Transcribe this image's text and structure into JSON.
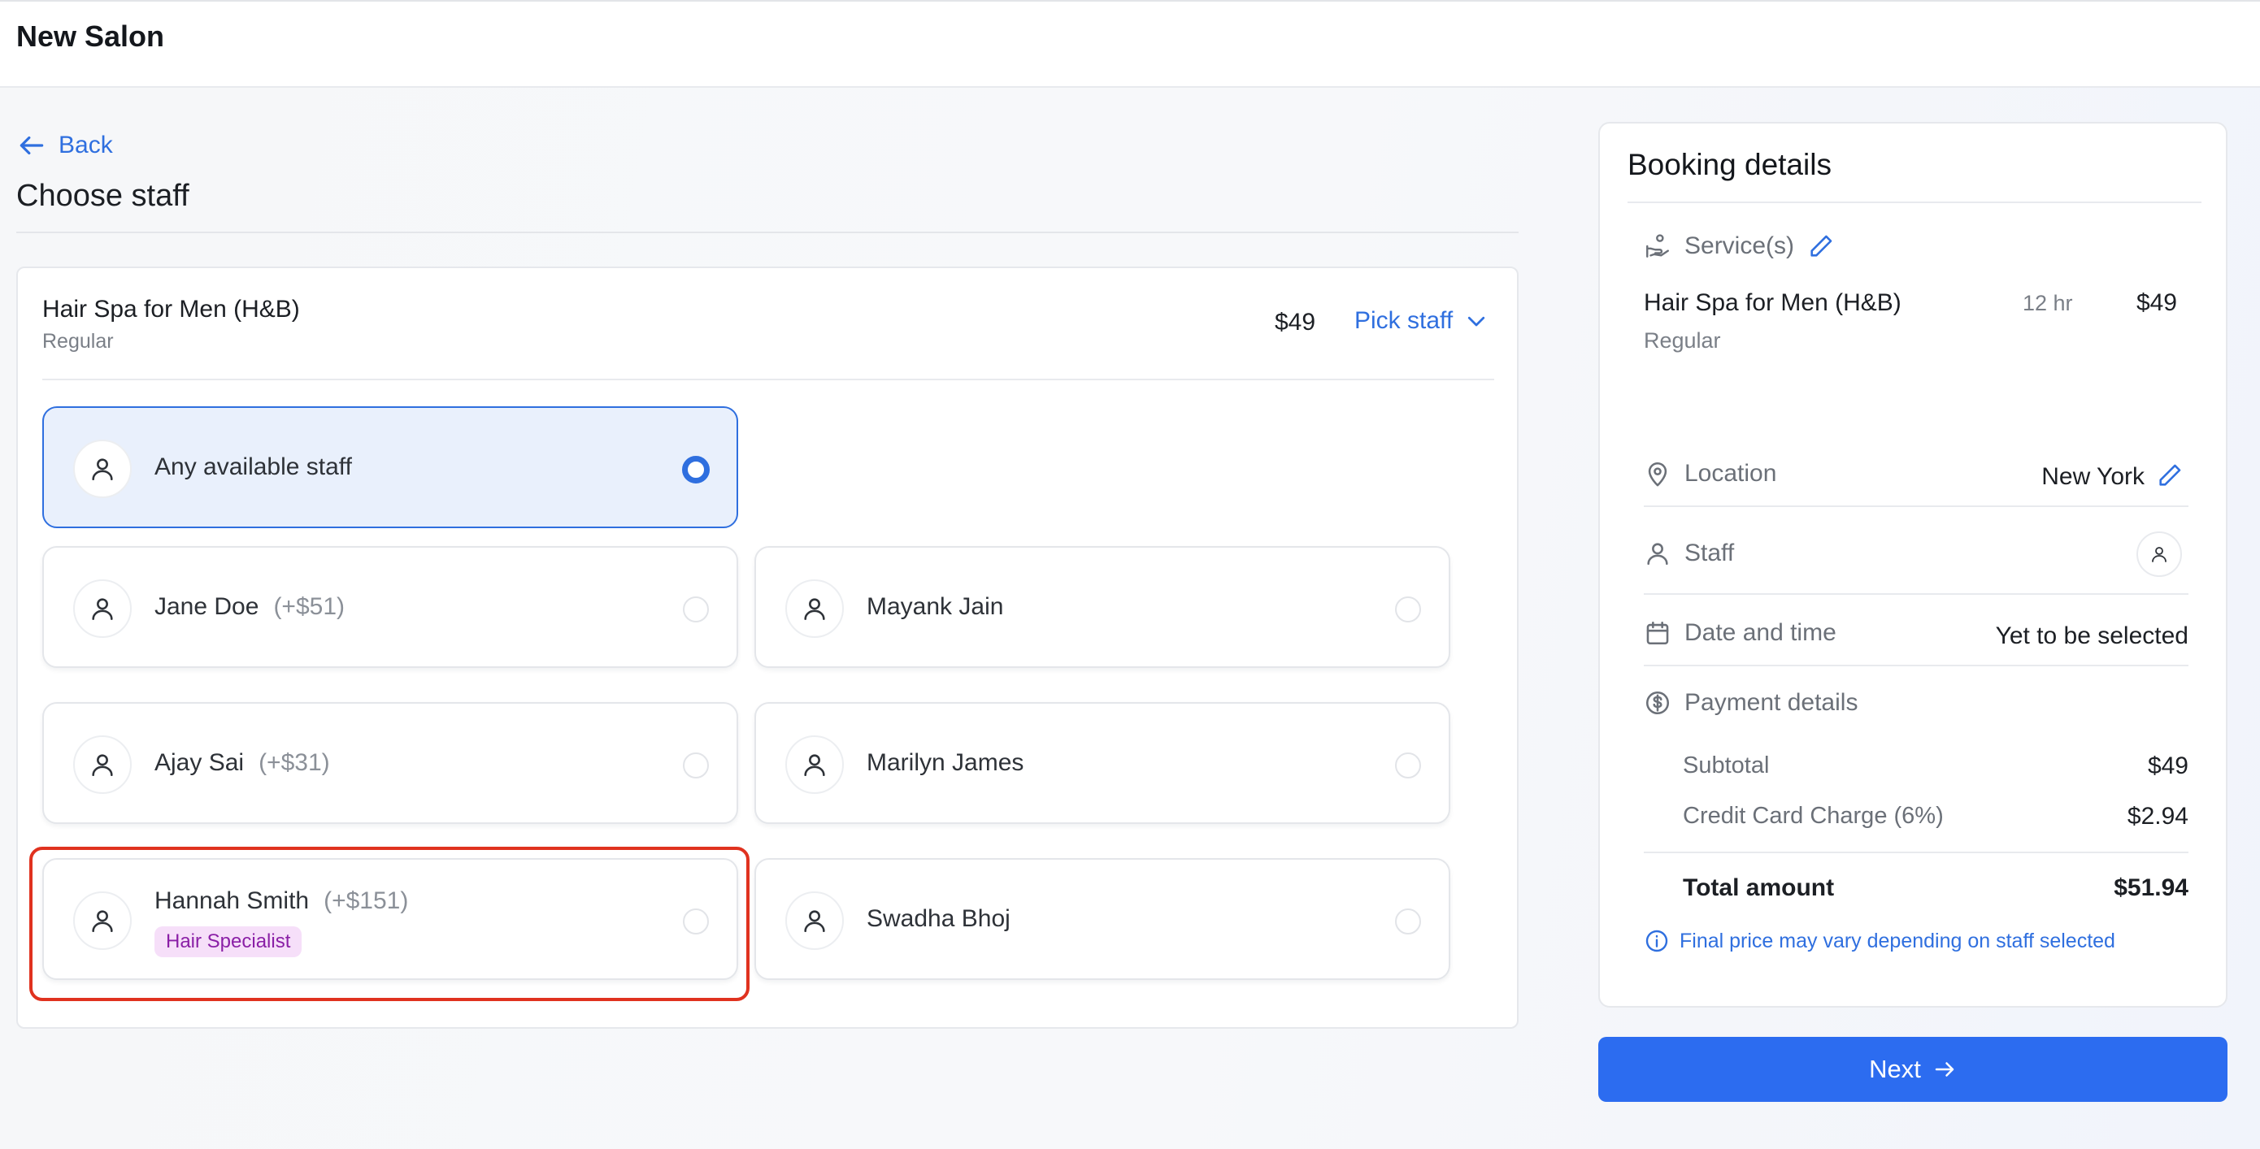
{
  "app": {
    "title": "New Salon"
  },
  "nav": {
    "back_label": "Back"
  },
  "page": {
    "title": "Choose staff"
  },
  "service": {
    "name": "Hair Spa for Men (H&B)",
    "variant": "Regular",
    "price": "$49",
    "pick_staff_label": "Pick staff"
  },
  "staff": [
    {
      "name": "Any available staff",
      "extra": "",
      "badge": "",
      "selected": true
    },
    {
      "name": "Jane Doe",
      "extra": "(+$51)",
      "badge": "",
      "selected": false
    },
    {
      "name": "Mayank Jain",
      "extra": "",
      "badge": "",
      "selected": false
    },
    {
      "name": "Ajay Sai",
      "extra": "(+$31)",
      "badge": "",
      "selected": false
    },
    {
      "name": "Marilyn James",
      "extra": "",
      "badge": "",
      "selected": false
    },
    {
      "name": "Hannah Smith",
      "extra": "(+$151)",
      "badge": "Hair Specialist",
      "selected": false
    },
    {
      "name": "Swadha Bhoj",
      "extra": "",
      "badge": "",
      "selected": false
    }
  ],
  "booking": {
    "title": "Booking details",
    "services_label": "Service(s)",
    "service_name": "Hair Spa for Men (H&B)",
    "service_duration": "12 hr",
    "service_price": "$49",
    "service_variant": "Regular",
    "location_label": "Location",
    "location_value": "New York",
    "staff_label": "Staff",
    "datetime_label": "Date and time",
    "datetime_value": "Yet to be selected",
    "payment_label": "Payment details",
    "subtotal_label": "Subtotal",
    "subtotal_value": "$49",
    "cc_label": "Credit Card Charge (6%)",
    "cc_value": "$2.94",
    "total_label": "Total amount",
    "total_value": "$51.94",
    "note": "Final price may vary depending on staff selected"
  },
  "actions": {
    "next_label": "Next"
  },
  "colors": {
    "accent": "#2f6fdf",
    "next_button": "#2c6cf0",
    "selected_bg": "#e9f0fc",
    "badge_bg": "#f6dff9",
    "badge_text": "#8a1fa6",
    "highlight": "#e0321f"
  }
}
